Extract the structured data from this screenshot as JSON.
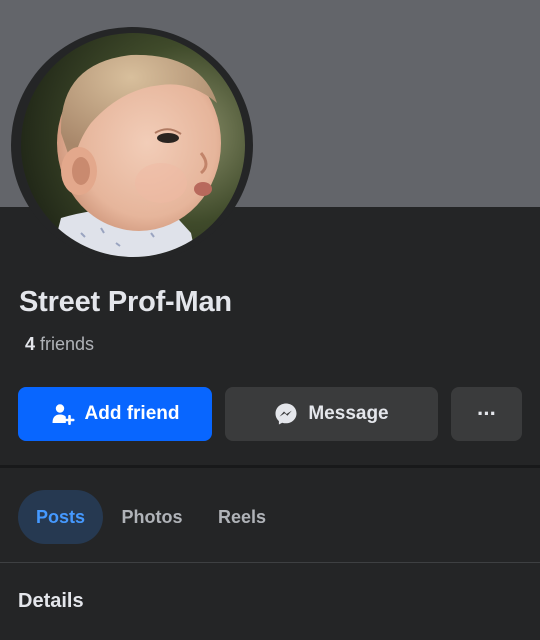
{
  "profile": {
    "name": "Street Prof-Man",
    "friends_count": "4",
    "friends_label": "friends"
  },
  "actions": {
    "add_friend_label": "Add friend",
    "message_label": "Message",
    "more_label": "···"
  },
  "tabs": [
    {
      "label": "Posts",
      "active": true
    },
    {
      "label": "Photos",
      "active": false
    },
    {
      "label": "Reels",
      "active": false
    }
  ],
  "sections": {
    "details_heading": "Details"
  },
  "colors": {
    "background": "#242526",
    "cover": "#63656a",
    "primary": "#0866ff",
    "secondary_button": "#3a3b3c",
    "active_tab_bg": "#263951",
    "active_tab_text": "#4599ff"
  },
  "icons": {
    "add_friend": "person-plus-icon",
    "message": "messenger-icon",
    "more": "more-dots-icon"
  }
}
